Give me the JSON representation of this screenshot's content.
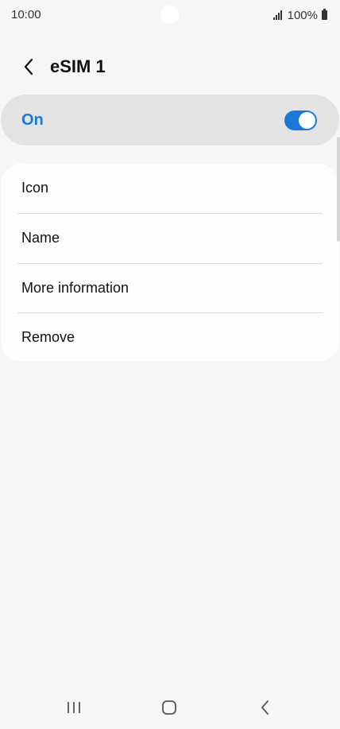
{
  "status_bar": {
    "time": "10:00",
    "battery": "100%",
    "signal_icon": "signal-bars-icon",
    "battery_icon": "battery-full-icon"
  },
  "header": {
    "title": "eSIM 1",
    "back_icon": "chevron-left-icon"
  },
  "master_switch": {
    "label": "On",
    "state": true,
    "accent_color": "#1a7ad8"
  },
  "settings_list": {
    "items": [
      {
        "label": "Icon"
      },
      {
        "label": "Name"
      },
      {
        "label": "More information"
      },
      {
        "label": "Remove"
      }
    ]
  },
  "nav_bar": {
    "recents_icon": "recent-apps-icon",
    "home_icon": "home-icon",
    "back_icon": "back-icon"
  }
}
